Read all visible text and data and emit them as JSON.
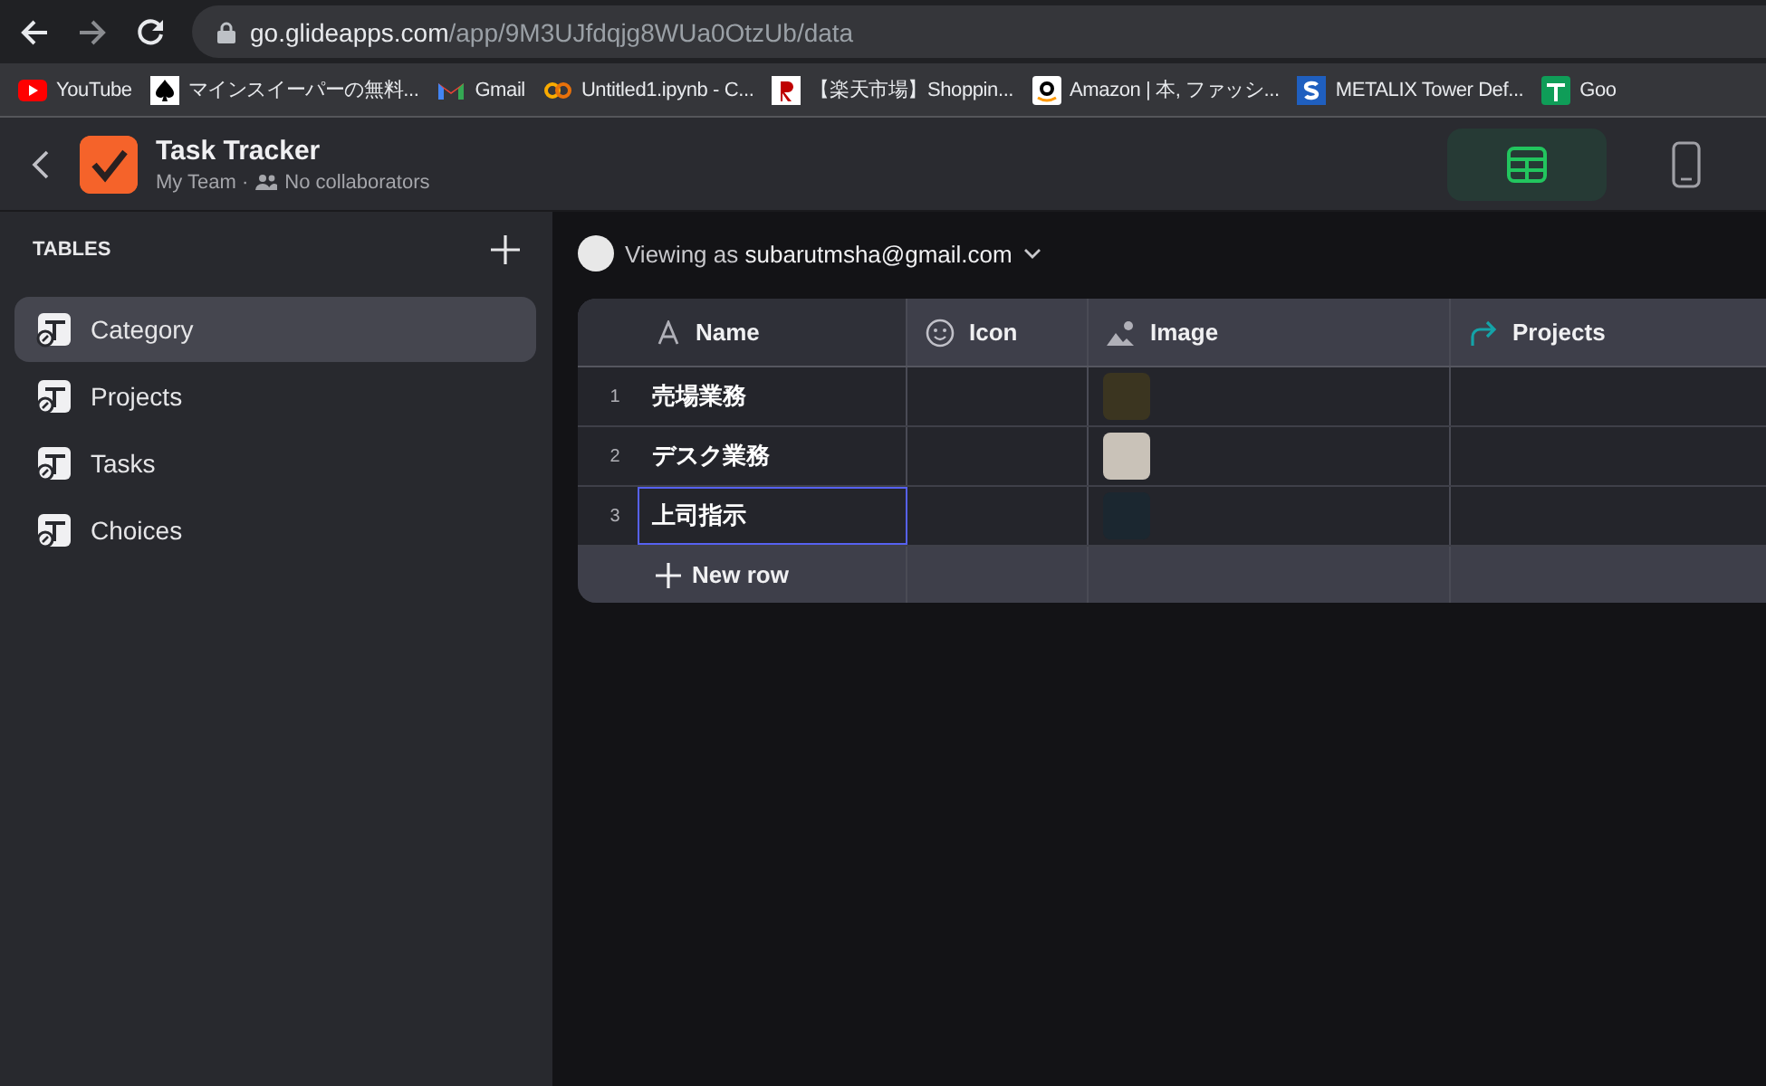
{
  "browser": {
    "url_host": "go.glideapps.com",
    "url_path": "/app/9M3UJfdqjg8WUa0OtzUb/data",
    "bookmarks": [
      {
        "kind": "youtube",
        "label": "YouTube"
      },
      {
        "kind": "spade",
        "label": "マインスイーパーの無料..."
      },
      {
        "kind": "gmail",
        "label": "Gmail"
      },
      {
        "kind": "colab",
        "label": "Untitled1.ipynb - C..."
      },
      {
        "kind": "rakuten",
        "label": "【楽天市場】Shoppin..."
      },
      {
        "kind": "amazon",
        "label": "Amazon | 本, ファッシ..."
      },
      {
        "kind": "metalix",
        "label": "METALIX Tower Def..."
      },
      {
        "kind": "sheets",
        "label": "Goo"
      }
    ]
  },
  "app": {
    "title": "Task Tracker",
    "team": "My Team",
    "separator": "·",
    "collaborators": "No collaborators",
    "views": [
      {
        "kind": "data",
        "selected": true
      },
      {
        "kind": "phone",
        "selected": false
      }
    ]
  },
  "sidebar": {
    "heading": "TABLES",
    "items": [
      {
        "label": "Category",
        "selected": true
      },
      {
        "label": "Projects",
        "selected": false
      },
      {
        "label": "Tasks",
        "selected": false
      },
      {
        "label": "Choices",
        "selected": false
      }
    ]
  },
  "viewing": {
    "prefix": "Viewing as",
    "user": "subarutmsha@gmail.com"
  },
  "table": {
    "columns": [
      {
        "kind": "text",
        "label": "Name"
      },
      {
        "kind": "emoji",
        "label": "Icon"
      },
      {
        "kind": "image",
        "label": "Image"
      },
      {
        "kind": "relation",
        "label": "Projects"
      }
    ],
    "rows": [
      {
        "number": "1",
        "name": "売場業務",
        "selected": false
      },
      {
        "number": "2",
        "name": "デスク業務",
        "selected": false
      },
      {
        "number": "3",
        "name": "上司指示",
        "selected": true
      }
    ],
    "new_row": "New row"
  }
}
